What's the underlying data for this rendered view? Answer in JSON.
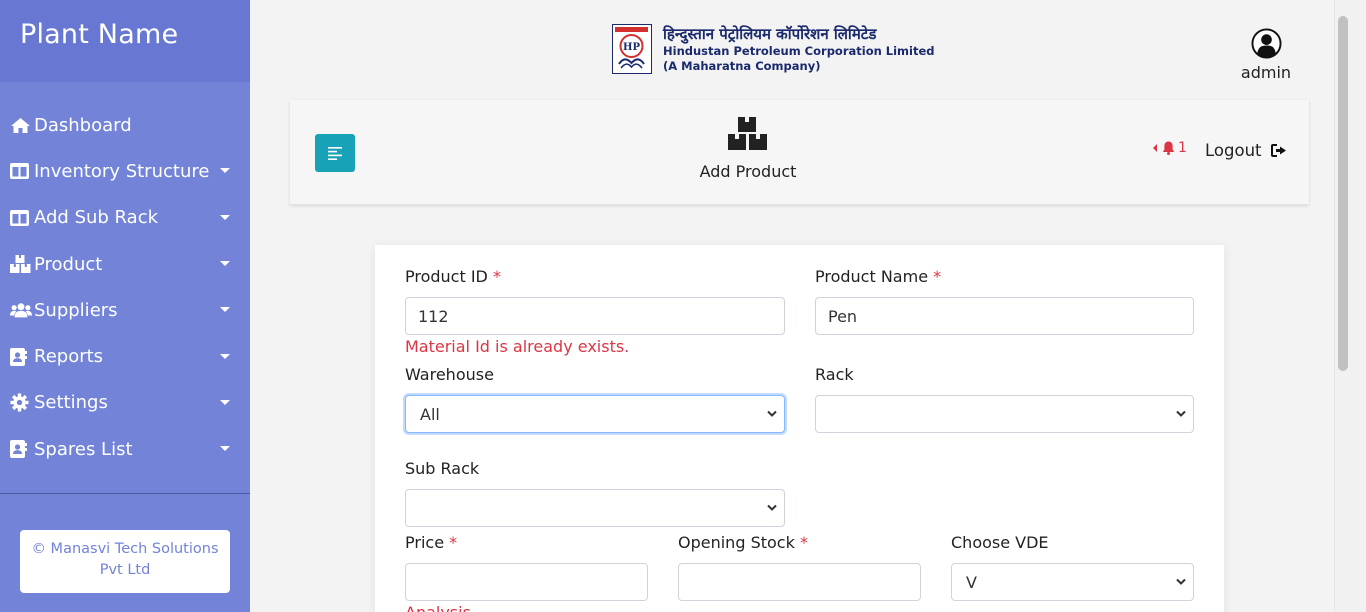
{
  "sidebar": {
    "brand": "Plant Name",
    "items": [
      {
        "label": "Dashboard",
        "icon": "home-icon",
        "caret": false
      },
      {
        "label": "Inventory Structure",
        "icon": "columns-icon",
        "caret": true
      },
      {
        "label": "Add Sub Rack",
        "icon": "columns-icon",
        "caret": true
      },
      {
        "label": "Product",
        "icon": "boxes-icon",
        "caret": true
      },
      {
        "label": "Suppliers",
        "icon": "users-icon",
        "caret": true
      },
      {
        "label": "Reports",
        "icon": "address-book-icon",
        "caret": true
      },
      {
        "label": "Settings",
        "icon": "gear-icon",
        "caret": true
      },
      {
        "label": "Spares List",
        "icon": "address-book-icon",
        "caret": true
      }
    ],
    "copyright": "© Manasvi Tech Solutions Pvt Ltd"
  },
  "header": {
    "logo_hindi": "हिन्दुस्तान पेट्रोलियम कॉर्पोरेशन लिमिटेड",
    "logo_english": "Hindustan Petroleum Corporation Limited",
    "logo_tagline": "(A Maharatna Company)",
    "logo_emblem_text": "HP",
    "user_name": "admin"
  },
  "topbar": {
    "page_title": "Add Product",
    "notification_count": "1",
    "logout_label": "Logout"
  },
  "form": {
    "product_id_label": "Product ID",
    "product_id_value": "112",
    "product_id_error": "Material Id is already exists.",
    "product_name_label": "Product Name",
    "product_name_value": "Pen",
    "warehouse_label": "Warehouse",
    "warehouse_value": "All",
    "rack_label": "Rack",
    "rack_value": "",
    "sub_rack_label": "Sub Rack",
    "sub_rack_value": "",
    "price_label": "Price",
    "price_value": "",
    "price_error_partial": "Analysis",
    "opening_stock_label": "Opening Stock",
    "opening_stock_value": "",
    "vde_label": "Choose VDE",
    "vde_value": "V",
    "required_mark": "*"
  },
  "colors": {
    "sidebar_bg": "#7283d8",
    "brand_bg": "#6878d2",
    "toggle_btn": "#17a2b8",
    "required": "#dc3545"
  }
}
